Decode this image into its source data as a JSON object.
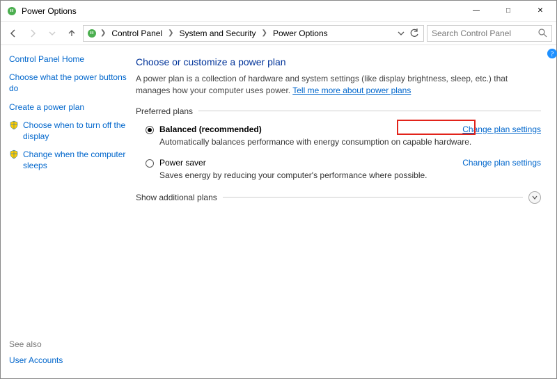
{
  "window": {
    "title": "Power Options"
  },
  "breadcrumb": {
    "items": [
      "Control Panel",
      "System and Security",
      "Power Options"
    ]
  },
  "search": {
    "placeholder": "Search Control Panel"
  },
  "sidebar": {
    "home": "Control Panel Home",
    "links": [
      "Choose what the power buttons do",
      "Create a power plan",
      "Choose when to turn off the display",
      "Change when the computer sleeps"
    ],
    "seealso_label": "See also",
    "seealso_links": [
      "User Accounts"
    ]
  },
  "main": {
    "heading": "Choose or customize a power plan",
    "description_a": "A power plan is a collection of hardware and system settings (like display brightness, sleep, etc.) that manages how your computer uses power. ",
    "description_link": "Tell me more about power plans",
    "preferred_label": "Preferred plans",
    "plans": [
      {
        "name": "Balanced (recommended)",
        "desc": "Automatically balances performance with energy consumption on capable hardware.",
        "link": "Change plan settings",
        "selected": true
      },
      {
        "name": "Power saver",
        "desc": "Saves energy by reducing your computer's performance where possible.",
        "link": "Change plan settings",
        "selected": false
      }
    ],
    "show_additional": "Show additional plans"
  }
}
